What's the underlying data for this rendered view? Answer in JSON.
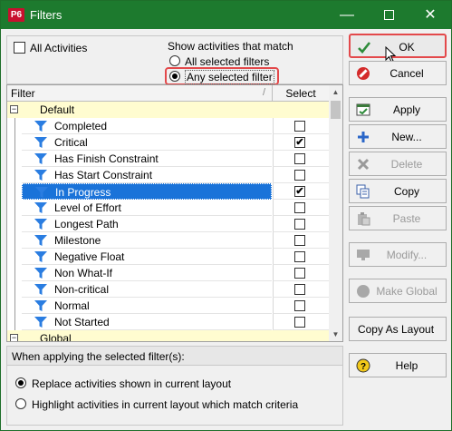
{
  "window": {
    "app_icon": "P6",
    "title": "Filters",
    "controls": {
      "minimize": "—",
      "maximize": "",
      "close": "✕"
    }
  },
  "top": {
    "all_activities_label": "All Activities",
    "all_activities_checked": false,
    "show_match_label": "Show activities that match",
    "match_options": [
      {
        "label": "All selected filters",
        "selected": false
      },
      {
        "label": "Any selected filter",
        "selected": true
      }
    ]
  },
  "grid": {
    "headers": {
      "filter": "Filter",
      "select": "Select"
    },
    "rows": [
      {
        "type": "group",
        "name": "Default",
        "expander": "−"
      },
      {
        "type": "item",
        "name": "Completed",
        "checked": false,
        "icon": "filter-icon"
      },
      {
        "type": "item",
        "name": "Critical",
        "checked": true,
        "icon": "filter-icon"
      },
      {
        "type": "item",
        "name": "Has Finish Constraint",
        "checked": false,
        "icon": "filter-icon"
      },
      {
        "type": "item",
        "name": "Has Start Constraint",
        "checked": false,
        "icon": "filter-icon"
      },
      {
        "type": "item",
        "name": "In Progress",
        "checked": true,
        "selected": true,
        "icon": "filter-icon"
      },
      {
        "type": "item",
        "name": "Level of Effort",
        "checked": false,
        "icon": "filter-icon"
      },
      {
        "type": "item",
        "name": "Longest Path",
        "checked": false,
        "icon": "filter-icon"
      },
      {
        "type": "item",
        "name": "Milestone",
        "checked": false,
        "icon": "filter-icon"
      },
      {
        "type": "item",
        "name": "Negative Float",
        "checked": false,
        "icon": "filter-icon"
      },
      {
        "type": "item",
        "name": "Non What-If",
        "checked": false,
        "icon": "filter-icon"
      },
      {
        "type": "item",
        "name": "Non-critical",
        "checked": false,
        "icon": "filter-icon"
      },
      {
        "type": "item",
        "name": "Normal",
        "checked": false,
        "icon": "filter-icon"
      },
      {
        "type": "item",
        "name": "Not Started",
        "checked": false,
        "icon": "filter-icon"
      },
      {
        "type": "group",
        "name": "Global",
        "expander": "−"
      }
    ],
    "check_mark": "✔"
  },
  "applying": {
    "heading": "When applying the selected filter(s):",
    "options": [
      {
        "label": "Replace activities shown in current layout",
        "selected": true
      },
      {
        "label": "Highlight activities in current layout which match criteria",
        "selected": false
      }
    ]
  },
  "buttons": [
    {
      "id": "ok",
      "label": "OK",
      "icon": "check-icon",
      "enabled": true
    },
    {
      "id": "cancel",
      "label": "Cancel",
      "icon": "cancel-icon",
      "enabled": true
    },
    {
      "id": "apply",
      "label": "Apply",
      "icon": "apply-icon",
      "enabled": true
    },
    {
      "id": "new",
      "label": "New...",
      "icon": "plus-icon",
      "enabled": true
    },
    {
      "id": "delete",
      "label": "Delete",
      "icon": "delete-icon",
      "enabled": false
    },
    {
      "id": "copy",
      "label": "Copy",
      "icon": "copy-icon",
      "enabled": true
    },
    {
      "id": "paste",
      "label": "Paste",
      "icon": "paste-icon",
      "enabled": false
    },
    {
      "id": "modify",
      "label": "Modify...",
      "icon": "monitor-icon",
      "enabled": false
    },
    {
      "id": "make_global",
      "label": "Make Global",
      "icon": "globe-icon",
      "enabled": false
    },
    {
      "id": "copy_as_layout",
      "label": "Copy As Layout",
      "icon": "",
      "enabled": true
    },
    {
      "id": "help",
      "label": "Help",
      "icon": "help-icon",
      "enabled": true
    }
  ],
  "colors": {
    "titlebar": "#1d7a2e",
    "selection": "#1a73d9",
    "group_row": "#fffcd0",
    "highlight": "#e3494b",
    "filter_icon": "#2a7de1"
  }
}
